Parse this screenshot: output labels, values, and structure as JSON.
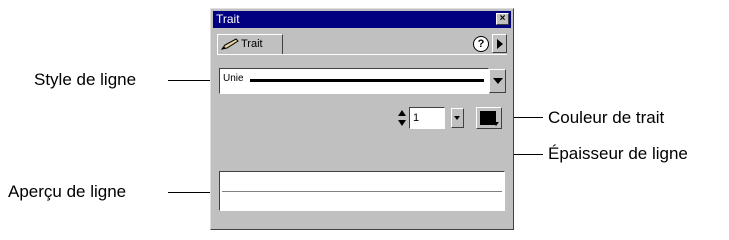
{
  "window": {
    "title": "Trait"
  },
  "tab": {
    "label": "Trait"
  },
  "help_label": "?",
  "stroke": {
    "style_value": "Unie",
    "thickness_value": "1",
    "color": "#000000"
  },
  "callouts": {
    "style": "Style de ligne",
    "color": "Couleur de trait",
    "thickness": "Épaisseur de ligne",
    "preview": "Aperçu de ligne"
  }
}
